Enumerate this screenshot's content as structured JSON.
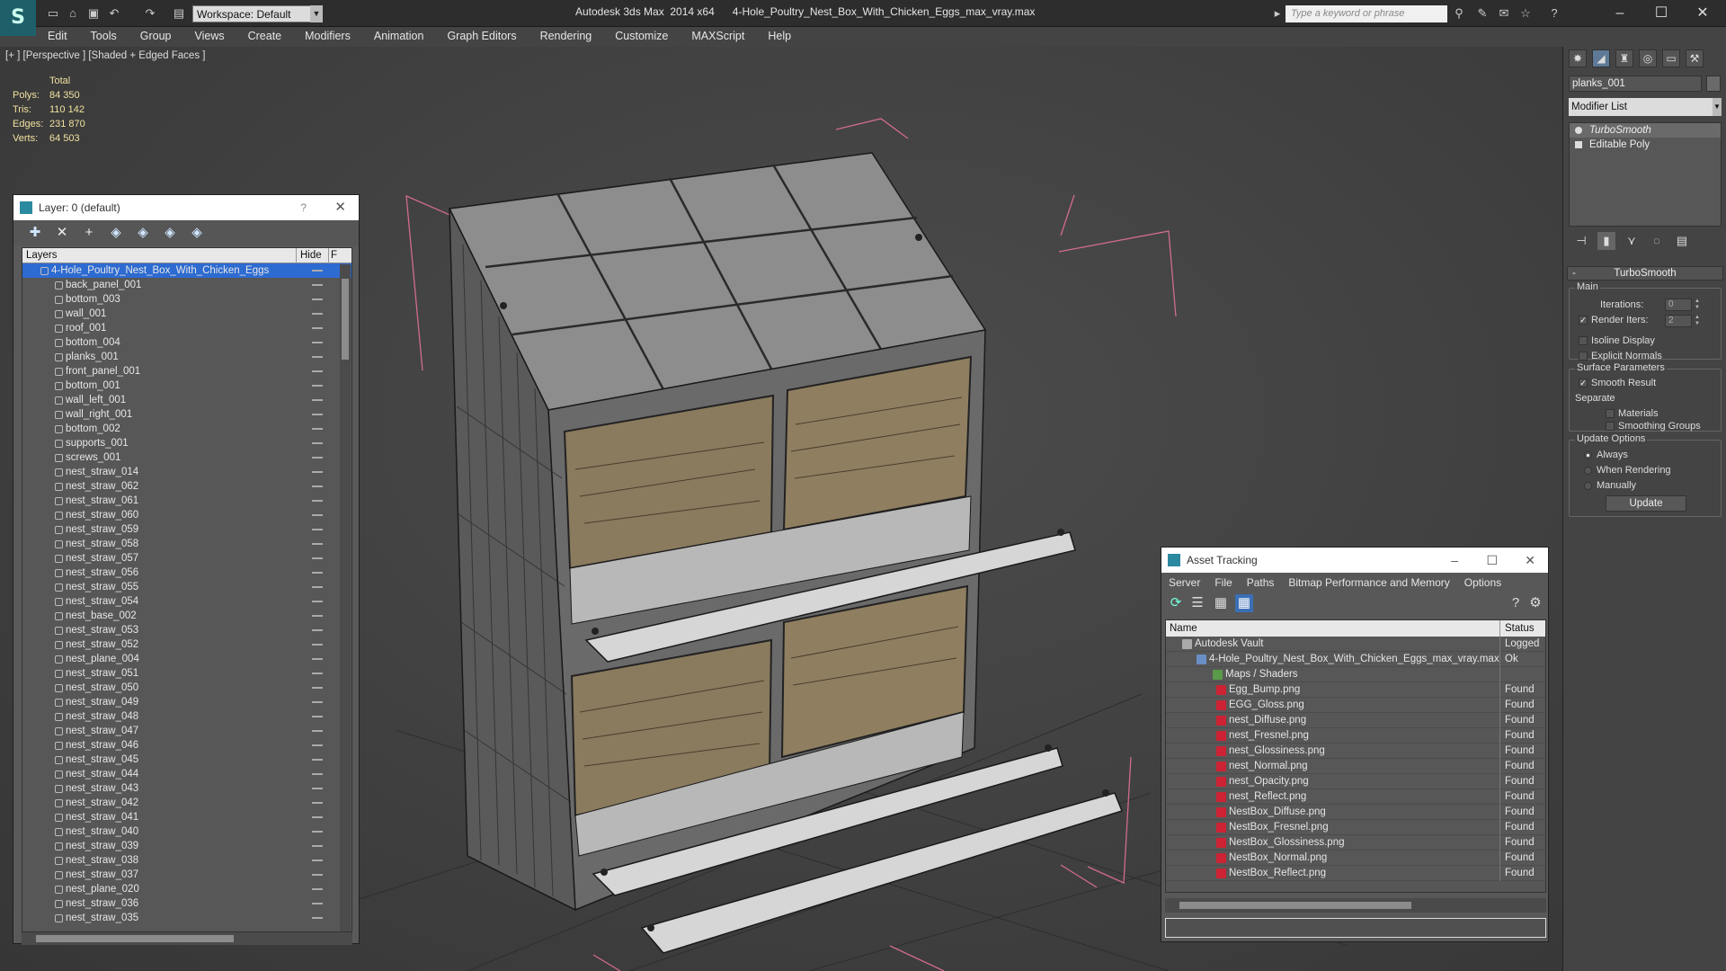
{
  "title": {
    "workspace": "Workspace: Default",
    "text": "Autodesk 3ds Max  2014 x64      4-Hole_Poultry_Nest_Box_With_Chicken_Eggs_max_vray.max",
    "search_placeholder": "Type a keyword or phrase"
  },
  "menu": [
    "Edit",
    "Tools",
    "Group",
    "Views",
    "Create",
    "Modifiers",
    "Animation",
    "Graph Editors",
    "Rendering",
    "Customize",
    "MAXScript",
    "Help"
  ],
  "viewport": {
    "label": "[+ ] [Perspective ] [Shaded + Edged Faces ]",
    "stats": {
      "header": "Total",
      "rows": [
        {
          "k": "Polys:",
          "v": "84 350"
        },
        {
          "k": "Tris:",
          "v": "110 142"
        },
        {
          "k": "Edges:",
          "v": "231 870"
        },
        {
          "k": "Verts:",
          "v": "64 503"
        }
      ]
    }
  },
  "layer_panel": {
    "title": "Layer: 0 (default)",
    "help": "?",
    "col_layers": "Layers",
    "col_hide": "Hide",
    "col_f": "F",
    "root": "4-Hole_Poultry_Nest_Box_With_Chicken_Eggs",
    "items": [
      "back_panel_001",
      "bottom_003",
      "wall_001",
      "roof_001",
      "bottom_004",
      "planks_001",
      "front_panel_001",
      "bottom_001",
      "wall_left_001",
      "wall_right_001",
      "bottom_002",
      "supports_001",
      "screws_001",
      "nest_straw_014",
      "nest_straw_062",
      "nest_straw_061",
      "nest_straw_060",
      "nest_straw_059",
      "nest_straw_058",
      "nest_straw_057",
      "nest_straw_056",
      "nest_straw_055",
      "nest_straw_054",
      "nest_base_002",
      "nest_straw_053",
      "nest_straw_052",
      "nest_plane_004",
      "nest_straw_051",
      "nest_straw_050",
      "nest_straw_049",
      "nest_straw_048",
      "nest_straw_047",
      "nest_straw_046",
      "nest_straw_045",
      "nest_straw_044",
      "nest_straw_043",
      "nest_straw_042",
      "nest_straw_041",
      "nest_straw_040",
      "nest_straw_039",
      "nest_straw_038",
      "nest_straw_037",
      "nest_plane_020",
      "nest_straw_036",
      "nest_straw_035"
    ]
  },
  "asset_panel": {
    "title": "Asset Tracking",
    "menu": [
      "Server",
      "File",
      "Paths",
      "Bitmap Performance and Memory",
      "Options"
    ],
    "col_name": "Name",
    "col_status": "Status",
    "vault": {
      "name": "Autodesk Vault",
      "status": "Logged"
    },
    "file": {
      "name": "4-Hole_Poultry_Nest_Box_With_Chicken_Eggs_max_vray.max",
      "status": "Ok"
    },
    "group": "Maps / Shaders",
    "maps": [
      {
        "name": "Egg_Bump.png",
        "status": "Found"
      },
      {
        "name": "EGG_Gloss.png",
        "status": "Found"
      },
      {
        "name": "nest_Diffuse.png",
        "status": "Found"
      },
      {
        "name": "nest_Fresnel.png",
        "status": "Found"
      },
      {
        "name": "nest_Glossiness.png",
        "status": "Found"
      },
      {
        "name": "nest_Normal.png",
        "status": "Found"
      },
      {
        "name": "nest_Opacity.png",
        "status": "Found"
      },
      {
        "name": "nest_Reflect.png",
        "status": "Found"
      },
      {
        "name": "NestBox_Diffuse.png",
        "status": "Found"
      },
      {
        "name": "NestBox_Fresnel.png",
        "status": "Found"
      },
      {
        "name": "NestBox_Glossiness.png",
        "status": "Found"
      },
      {
        "name": "NestBox_Normal.png",
        "status": "Found"
      },
      {
        "name": "NestBox_Reflect.png",
        "status": "Found"
      }
    ]
  },
  "command_panel": {
    "object_name": "planks_001",
    "modifier_list": "Modifier List",
    "stack": [
      "TurboSmooth",
      "Editable Poly"
    ],
    "rollout_title": "TurboSmooth",
    "main_label": "Main",
    "iterations_label": "Iterations:",
    "iterations_value": "0",
    "render_iters_label": "Render Iters:",
    "render_iters_value": "2",
    "isoline": "Isoline Display",
    "explicit_normals": "Explicit Normals",
    "surface_params": "Surface Parameters",
    "smooth_result": "Smooth Result",
    "separate": "Separate",
    "materials": "Materials",
    "smoothing_groups": "Smoothing Groups",
    "update_options": "Update Options",
    "always": "Always",
    "when_rendering": "When Rendering",
    "manually": "Manually",
    "update_button": "Update"
  }
}
